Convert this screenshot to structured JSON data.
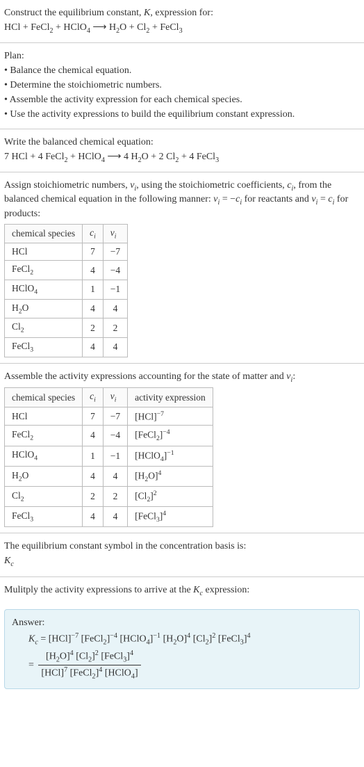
{
  "sec_intro": {
    "lead": "Construct the equilibrium constant, ",
    "kvar": "K",
    "lead2": ", expression for:",
    "eq_lhs_1": "HCl + FeCl",
    "eq_lhs_2": " + HClO",
    "arrow": "  ⟶  ",
    "eq_rhs_1": "H",
    "eq_rhs_2": "O + Cl",
    "eq_rhs_3": " + FeCl"
  },
  "sec_plan": {
    "title": "Plan:",
    "b1": "• Balance the chemical equation.",
    "b2": "• Determine the stoichiometric numbers.",
    "b3": "• Assemble the activity expression for each chemical species.",
    "b4": "• Use the activity expressions to build the equilibrium constant expression."
  },
  "sec_balanced": {
    "title": "Write the balanced chemical equation:",
    "c1": "7 HCl + 4 FeCl",
    "c2": " + HClO",
    "arrow": "  ⟶  ",
    "c3": "4 H",
    "c4": "O + 2 Cl",
    "c5": " + 4 FeCl"
  },
  "sec_assign": {
    "p1a": "Assign stoichiometric numbers, ",
    "nu": "ν",
    "p1b": ", using the stoichiometric coefficients, ",
    "ci": "c",
    "p1c": ", from the balanced chemical equation in the following manner: ",
    "eq1a": " = −",
    "eq1b": " for reactants and ",
    "eq2a": " = ",
    "eq2b": " for products:"
  },
  "table1": {
    "h1": "chemical species",
    "h2": "c",
    "h3": "ν",
    "rows": [
      {
        "sp": "HCl",
        "sub": "",
        "c": "7",
        "v": "−7"
      },
      {
        "sp": "FeCl",
        "sub": "2",
        "c": "4",
        "v": "−4"
      },
      {
        "sp": "HClO",
        "sub": "4",
        "c": "1",
        "v": "−1"
      },
      {
        "sp": "H",
        "sub": "2",
        "sp2": "O",
        "c": "4",
        "v": "4"
      },
      {
        "sp": "Cl",
        "sub": "2",
        "c": "2",
        "v": "2"
      },
      {
        "sp": "FeCl",
        "sub": "3",
        "c": "4",
        "v": "4"
      }
    ]
  },
  "sec_activity": {
    "title_a": "Assemble the activity expressions accounting for the state of matter and ",
    "title_b": ":"
  },
  "table2": {
    "h1": "chemical species",
    "h2": "c",
    "h3": "ν",
    "h4": "activity expression",
    "rows": [
      {
        "sp": "HCl",
        "sub": "",
        "c": "7",
        "v": "−7",
        "ax": "[HCl]",
        "ex": "−7"
      },
      {
        "sp": "FeCl",
        "sub": "2",
        "c": "4",
        "v": "−4",
        "ax": "[FeCl",
        "axs": "2",
        "ax2": "]",
        "ex": "−4"
      },
      {
        "sp": "HClO",
        "sub": "4",
        "c": "1",
        "v": "−1",
        "ax": "[HClO",
        "axs": "4",
        "ax2": "]",
        "ex": "−1"
      },
      {
        "sp": "H",
        "sub": "2",
        "sp2": "O",
        "c": "4",
        "v": "4",
        "ax": "[H",
        "axs": "2",
        "ax2": "O]",
        "ex": "4"
      },
      {
        "sp": "Cl",
        "sub": "2",
        "c": "2",
        "v": "2",
        "ax": "[Cl",
        "axs": "2",
        "ax2": "]",
        "ex": "2"
      },
      {
        "sp": "FeCl",
        "sub": "3",
        "c": "4",
        "v": "4",
        "ax": "[FeCl",
        "axs": "3",
        "ax2": "]",
        "ex": "4"
      }
    ]
  },
  "sec_symbol": {
    "line1": "The equilibrium constant symbol in the concentration basis is:",
    "sym": "K",
    "sub": "c"
  },
  "sec_multiply": {
    "line": "Mulitply the activity expressions to arrive at the ",
    "sym": "K",
    "sub": "c",
    "line2": " expression:"
  },
  "answer": {
    "label": "Answer:",
    "lhs": "K",
    "eqs": " = ",
    "t1": "[HCl]",
    "e1": "−7",
    "t2": " [FeCl",
    "s2": "2",
    "t2b": "]",
    "e2": "−4",
    "t3": " [HClO",
    "s3": "4",
    "t3b": "]",
    "e3": "−1",
    "t4": " [H",
    "s4": "2",
    "t4b": "O]",
    "e4": "4",
    "t5": " [Cl",
    "s5": "2",
    "t5b": "]",
    "e5": "2",
    "t6": " [FeCl",
    "s6": "3",
    "t6b": "]",
    "e6": "4",
    "num_a": "[H",
    "num_as": "2",
    "num_a2": "O]",
    "num_ae": "4",
    "num_b": " [Cl",
    "num_bs": "2",
    "num_b2": "]",
    "num_be": "2",
    "num_c": " [FeCl",
    "num_cs": "3",
    "num_c2": "]",
    "num_ce": "4",
    "den_a": "[HCl]",
    "den_ae": "7",
    "den_b": " [FeCl",
    "den_bs": "2",
    "den_b2": "]",
    "den_be": "4",
    "den_c": " [HClO",
    "den_cs": "4",
    "den_c2": "]"
  }
}
